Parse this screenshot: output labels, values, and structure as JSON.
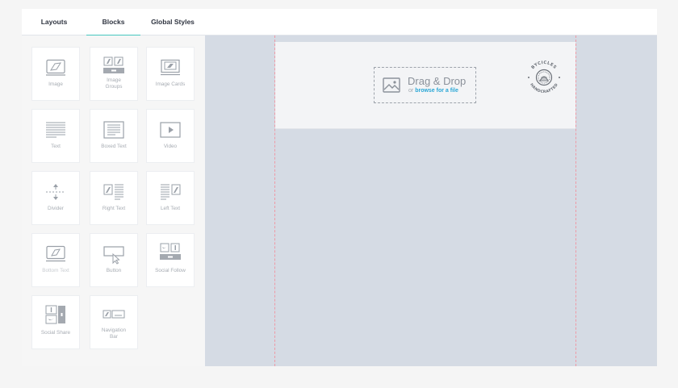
{
  "tabs": [
    {
      "label": "Layouts",
      "active": false
    },
    {
      "label": "Blocks",
      "active": true
    },
    {
      "label": "Global Styles",
      "active": false
    }
  ],
  "blocks": [
    {
      "label": "Image",
      "icon": "image-icon"
    },
    {
      "label": "Image Groups",
      "icon": "image-group-icon"
    },
    {
      "label": "Image Cards",
      "icon": "image-card-icon"
    },
    {
      "label": "Text",
      "icon": "text-icon"
    },
    {
      "label": "Boxed Text",
      "icon": "boxed-text-icon"
    },
    {
      "label": "Video",
      "icon": "video-icon"
    },
    {
      "label": "Divider",
      "icon": "divider-icon"
    },
    {
      "label": "Right Text",
      "icon": "right-text-icon"
    },
    {
      "label": "Left Text",
      "icon": "left-text-icon"
    },
    {
      "label": "Bottom Text",
      "icon": "bottom-text-icon"
    },
    {
      "label": "Button",
      "icon": "button-icon"
    },
    {
      "label": "Social Follow",
      "icon": "social-follow-icon"
    },
    {
      "label": "Social Share",
      "icon": "social-share-icon"
    },
    {
      "label": "Navigation Bar",
      "icon": "navigation-bar-icon"
    }
  ],
  "dropzone": {
    "title": "Drag & Drop",
    "prefix": "or",
    "link": "browse for a file"
  },
  "logo": {
    "top_text": "BYCICLES",
    "bottom_text": "HANDCRAFTED"
  },
  "colors": {
    "accent": "#46c8c0",
    "link": "#2aa7d6",
    "canvas": "#d5dbe4",
    "guide": "#ee9aa6"
  }
}
